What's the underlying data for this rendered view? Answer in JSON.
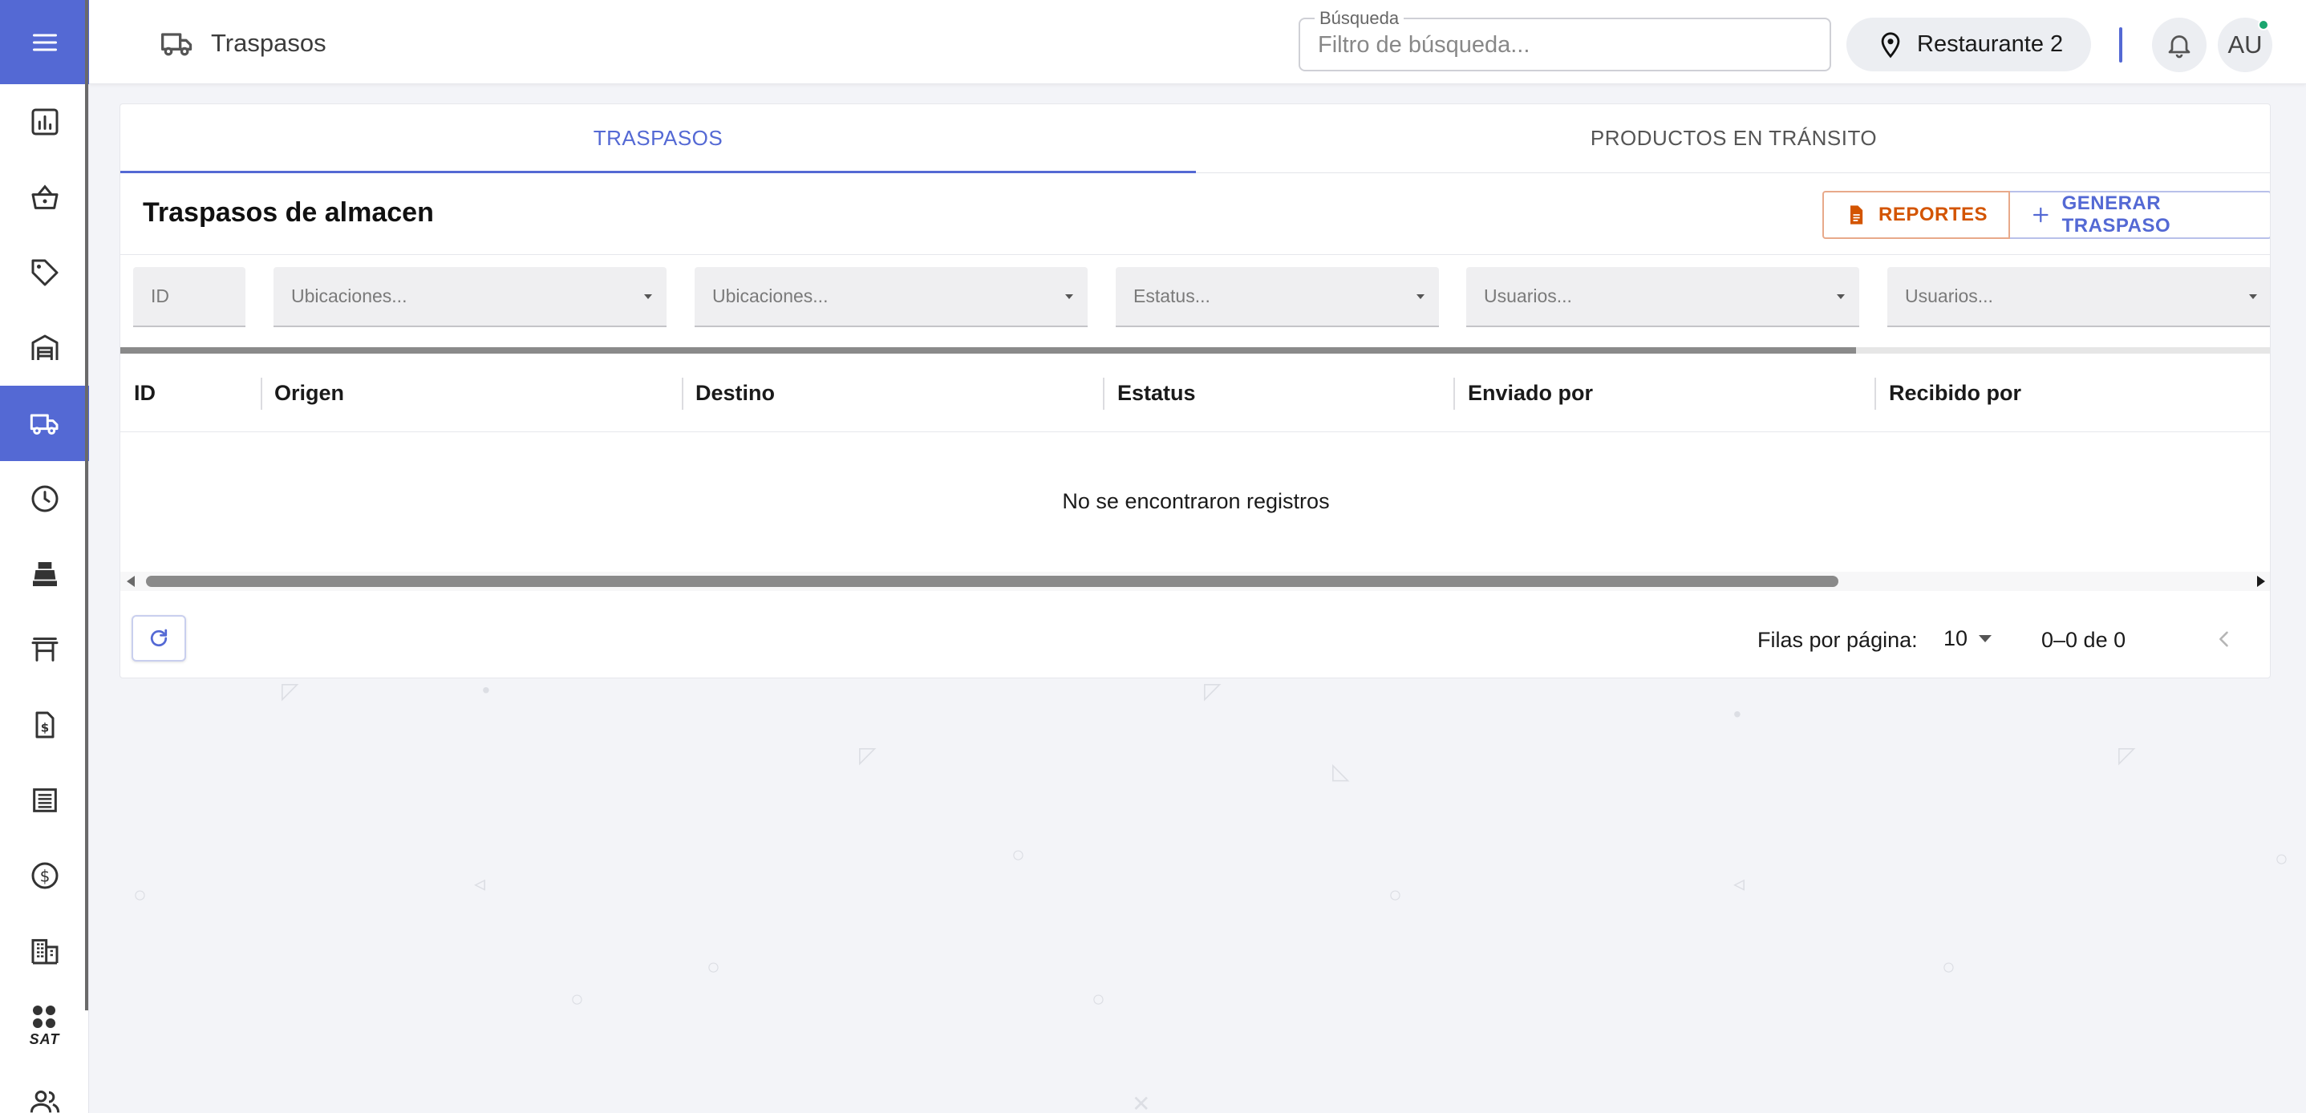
{
  "colors": {
    "accent": "#5469d4",
    "reports": "#d35400",
    "online": "#1aa56e"
  },
  "sidebar": {
    "menu_icon": "hamburger-menu-icon",
    "items": [
      {
        "icon": "bar-chart-icon",
        "active": false
      },
      {
        "icon": "basket-icon",
        "active": false
      },
      {
        "icon": "tag-icon",
        "active": false
      },
      {
        "icon": "warehouse-icon",
        "active": false
      },
      {
        "icon": "truck-icon",
        "active": true
      },
      {
        "icon": "clock-icon",
        "active": false
      },
      {
        "icon": "cash-register-icon",
        "active": false
      },
      {
        "icon": "table-icon",
        "active": false
      },
      {
        "icon": "invoice-icon",
        "active": false
      },
      {
        "icon": "receipt-icon",
        "active": false
      },
      {
        "icon": "dollar-icon",
        "active": false
      },
      {
        "icon": "building-icon",
        "active": false
      },
      {
        "icon": "sat-icon",
        "label": "SAT",
        "active": false
      },
      {
        "icon": "users-icon",
        "active": false
      }
    ]
  },
  "header": {
    "title": "Traspasos",
    "search": {
      "legend": "Búsqueda",
      "placeholder": "Filtro de búsqueda...",
      "value": ""
    },
    "location": "Restaurante 2",
    "avatar_initials": "AU"
  },
  "tabs": [
    {
      "label": "TRASPASOS",
      "active": true
    },
    {
      "label": "PRODUCTOS EN TRÁNSITO",
      "active": false
    }
  ],
  "card": {
    "title": "Traspasos de almacen",
    "reports_label": "REPORTES",
    "generate_label": "GENERAR TRASPASO"
  },
  "filters": {
    "id": "ID",
    "origin": "Ubicaciones...",
    "destination": "Ubicaciones...",
    "status": "Estatus...",
    "sent_by": "Usuarios...",
    "received_by": "Usuarios..."
  },
  "loading_progress": 0.807,
  "table": {
    "columns": [
      "ID",
      "Origen",
      "Destino",
      "Estatus",
      "Enviado por",
      "Recibido por"
    ],
    "rows": [],
    "empty_message": "No se encontraron registros"
  },
  "pagination": {
    "rows_per_page_label": "Filas por página:",
    "rows_per_page": "10",
    "range": "0–0 de 0"
  }
}
